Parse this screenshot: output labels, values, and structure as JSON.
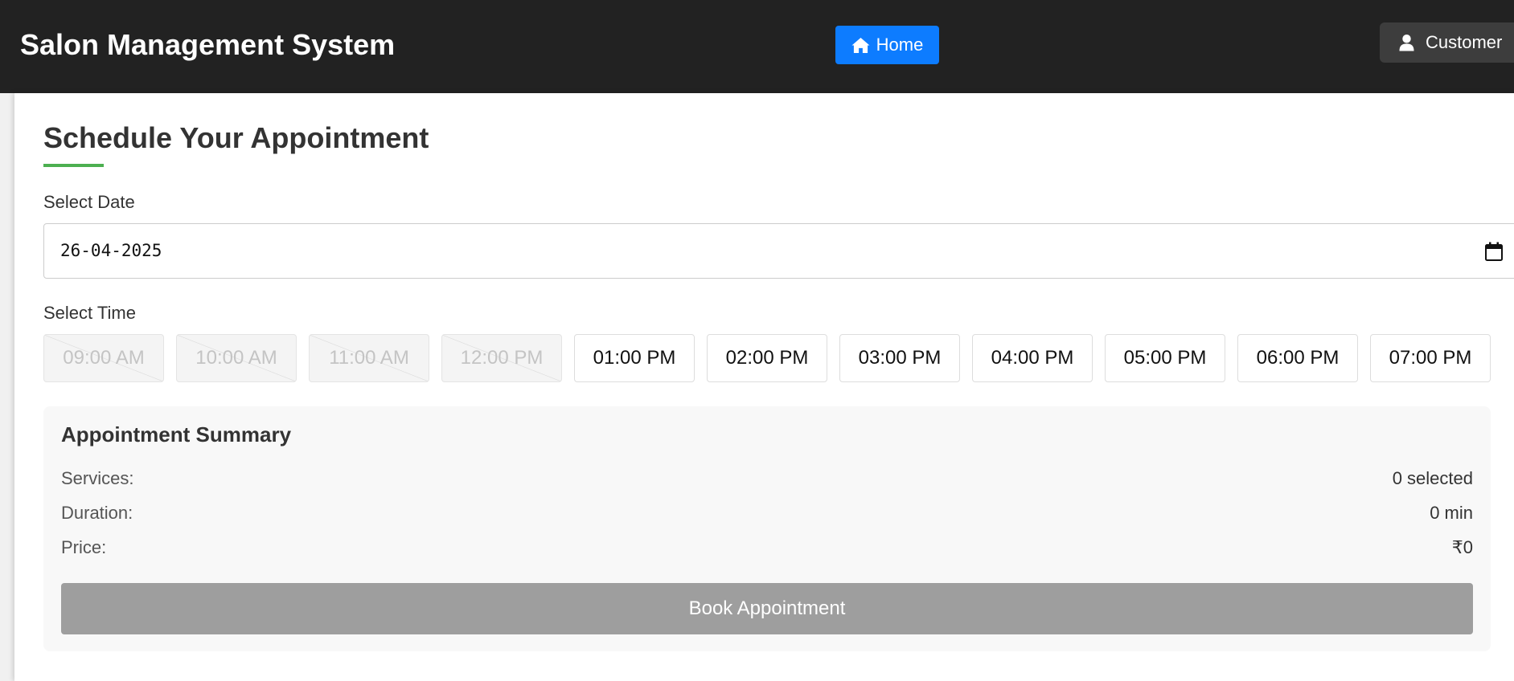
{
  "navbar": {
    "brand": "Salon Management System",
    "home_label": "Home",
    "customer_label": "Customer"
  },
  "page": {
    "title": "Schedule Your Appointment",
    "accent_color": "#4caf50"
  },
  "date_section": {
    "label": "Select Date",
    "value": "26-04-2025"
  },
  "time_section": {
    "label": "Select Time",
    "slots": [
      {
        "label": "09:00 AM",
        "available": false
      },
      {
        "label": "10:00 AM",
        "available": false
      },
      {
        "label": "11:00 AM",
        "available": false
      },
      {
        "label": "12:00 PM",
        "available": false
      },
      {
        "label": "01:00 PM",
        "available": true
      },
      {
        "label": "02:00 PM",
        "available": true
      },
      {
        "label": "03:00 PM",
        "available": true
      },
      {
        "label": "04:00 PM",
        "available": true
      },
      {
        "label": "05:00 PM",
        "available": true
      },
      {
        "label": "06:00 PM",
        "available": true
      },
      {
        "label": "07:00 PM",
        "available": true
      }
    ]
  },
  "summary": {
    "title": "Appointment Summary",
    "rows": [
      {
        "label": "Services:",
        "value": "0 selected"
      },
      {
        "label": "Duration:",
        "value": "0 min"
      },
      {
        "label": "Price:",
        "value": "₹0"
      }
    ],
    "book_label": "Book Appointment"
  },
  "icons": {
    "home": "home-icon",
    "customer": "user-icon",
    "calendar": "calendar-icon"
  },
  "colors": {
    "navbar_bg": "#222222",
    "home_button": "#0d7cff",
    "book_button_disabled": "#9e9e9e"
  }
}
